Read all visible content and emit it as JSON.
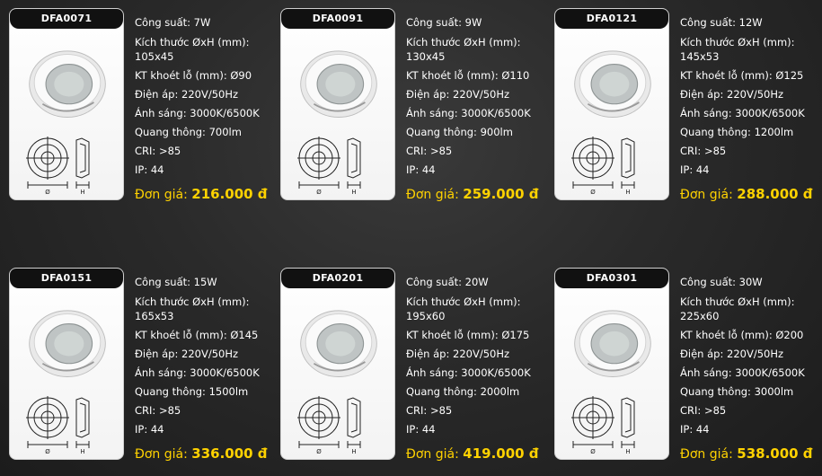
{
  "price_prefix": "Đơn giá:",
  "colors": {
    "price": "#ffd200",
    "text": "#ffffff",
    "tab": "#111111"
  },
  "products": [
    {
      "code": "DFA0071",
      "power": "Công suất: 7W",
      "size": "Kích thước ØxH (mm):\n105x45",
      "cutout": "KT khoét lỗ (mm): Ø90",
      "voltage": "Điện áp: 220V/50Hz",
      "light": "Ánh sáng: 3000K/6500K",
      "flux": "Quang thông: 700lm",
      "cri": "CRI: >85",
      "ip": "IP: 44",
      "price": "216.000 đ"
    },
    {
      "code": "DFA0091",
      "power": "Công suất: 9W",
      "size": "Kích thước ØxH (mm):\n130x45",
      "cutout": "KT khoét lỗ (mm): Ø110",
      "voltage": "Điện áp: 220V/50Hz",
      "light": "Ánh sáng: 3000K/6500K",
      "flux": "Quang thông: 900lm",
      "cri": "CRI: >85",
      "ip": "IP: 44",
      "price": "259.000 đ"
    },
    {
      "code": "DFA0121",
      "power": "Công suất: 12W",
      "size": "Kích thước ØxH (mm):\n145x53",
      "cutout": "KT khoét lỗ (mm): Ø125",
      "voltage": "Điện áp: 220V/50Hz",
      "light": "Ánh sáng: 3000K/6500K",
      "flux": "Quang thông: 1200lm",
      "cri": "CRI: >85",
      "ip": "IP: 44",
      "price": "288.000 đ"
    },
    {
      "code": "DFA0151",
      "power": "Công suất: 15W",
      "size": "Kích thước ØxH (mm):\n165x53",
      "cutout": "KT khoét lỗ (mm): Ø145",
      "voltage": "Điện áp: 220V/50Hz",
      "light": "Ánh sáng: 3000K/6500K",
      "flux": "Quang thông: 1500lm",
      "cri": "CRI: >85",
      "ip": "IP: 44",
      "price": "336.000 đ"
    },
    {
      "code": "DFA0201",
      "power": "Công suất: 20W",
      "size": "Kích thước ØxH (mm):\n195x60",
      "cutout": "KT khoét lỗ (mm): Ø175",
      "voltage": "Điện áp: 220V/50Hz",
      "light": "Ánh sáng: 3000K/6500K",
      "flux": "Quang thông: 2000lm",
      "cri": "CRI: >85",
      "ip": "IP: 44",
      "price": "419.000 đ"
    },
    {
      "code": "DFA0301",
      "power": "Công suất: 30W",
      "size": "Kích thước ØxH (mm):\n225x60",
      "cutout": "KT khoét lỗ (mm): Ø200",
      "voltage": "Điện áp: 220V/50Hz",
      "light": "Ánh sáng: 3000K/6500K",
      "flux": "Quang thông: 3000lm",
      "cri": "CRI: >85",
      "ip": "IP: 44",
      "price": "538.000 đ"
    }
  ],
  "diagram_labels": {
    "diameter": "Ø",
    "height": "H"
  }
}
